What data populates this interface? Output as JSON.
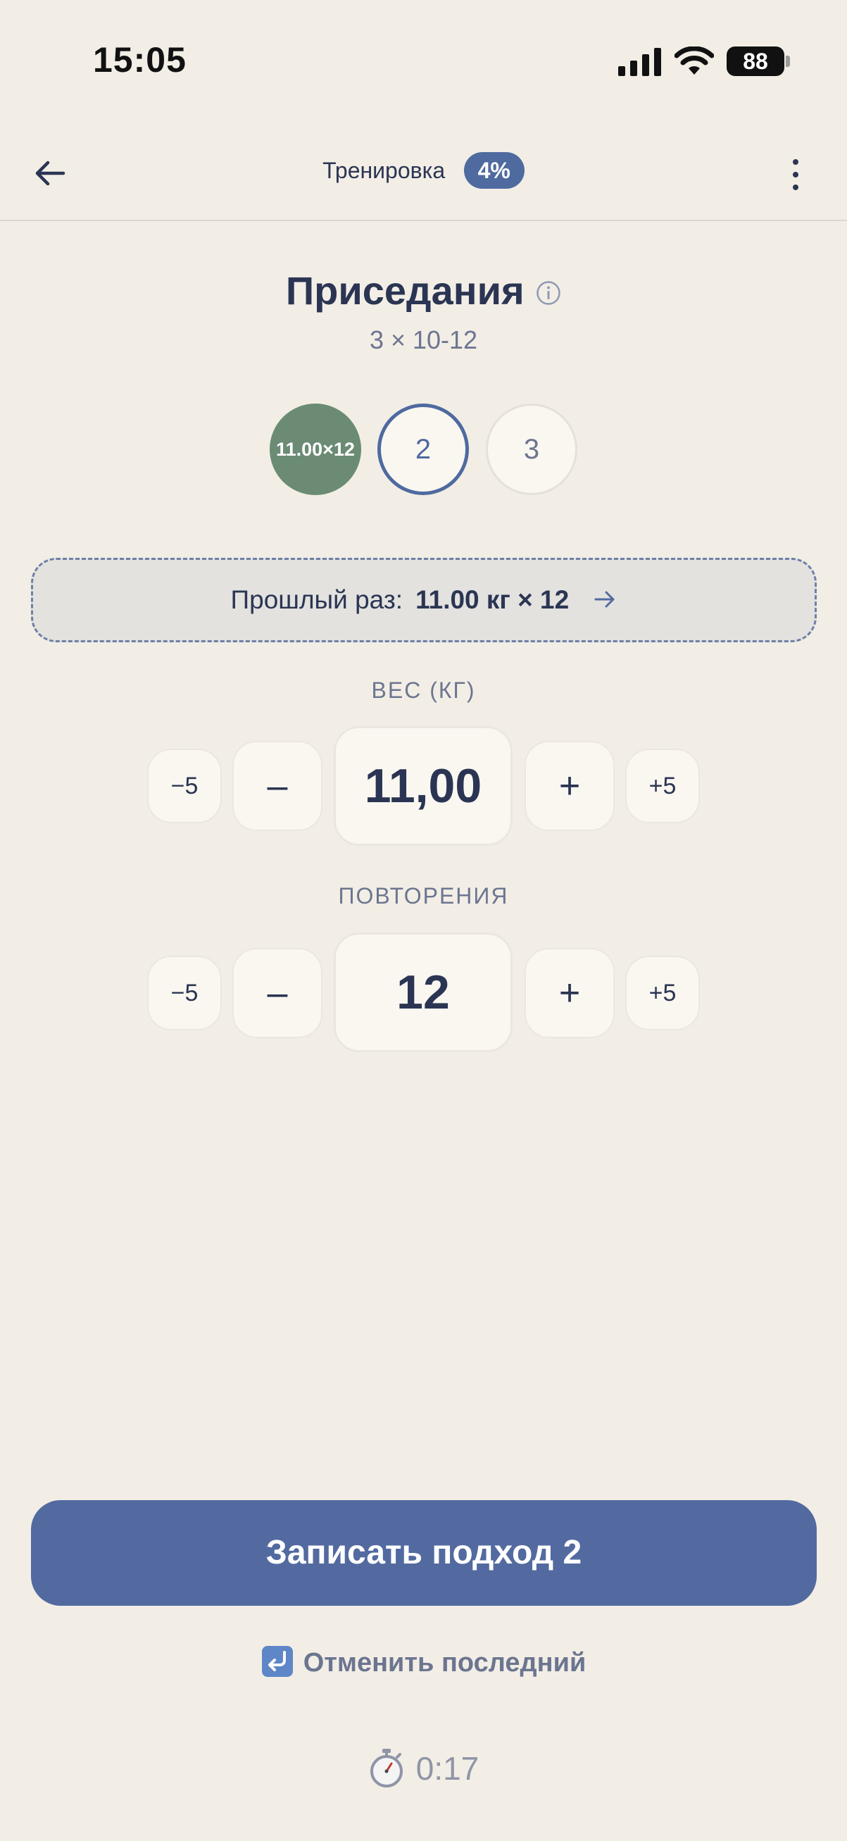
{
  "status_bar": {
    "time": "15:05",
    "battery": "88"
  },
  "header": {
    "title": "Тренировка",
    "progress": "4%"
  },
  "exercise": {
    "name": "Приседания",
    "scheme": "3 × 10-12"
  },
  "sets": [
    {
      "label": "11.00×12",
      "state": "done"
    },
    {
      "label": "2",
      "state": "active"
    },
    {
      "label": "3",
      "state": "pending"
    }
  ],
  "previous": {
    "label": "Прошлый раз:",
    "value": "11.00 кг × 12"
  },
  "weight": {
    "label": "ВЕС (КГ)",
    "value": "11,00",
    "minus_big": "−5",
    "minus": "–",
    "plus": "+",
    "plus_big": "+5"
  },
  "reps": {
    "label": "ПОВТОРЕНИЯ",
    "value": "12",
    "minus_big": "−5",
    "minus": "–",
    "plus": "+",
    "plus_big": "+5"
  },
  "actions": {
    "log_set": "Записать подход 2",
    "undo": "Отменить последний"
  },
  "timer": {
    "value": "0:17"
  },
  "colors": {
    "background": "#f2eee6",
    "accent": "#536aa0",
    "done": "#6b8b74",
    "text": "#2b3553",
    "muted": "#6c7590"
  },
  "icons": {
    "back": "arrow-left-icon",
    "more": "more-vertical-icon",
    "info": "info-icon",
    "previous_arrow": "arrow-right-icon",
    "undo": "undo-icon",
    "timer": "stopwatch-icon"
  }
}
